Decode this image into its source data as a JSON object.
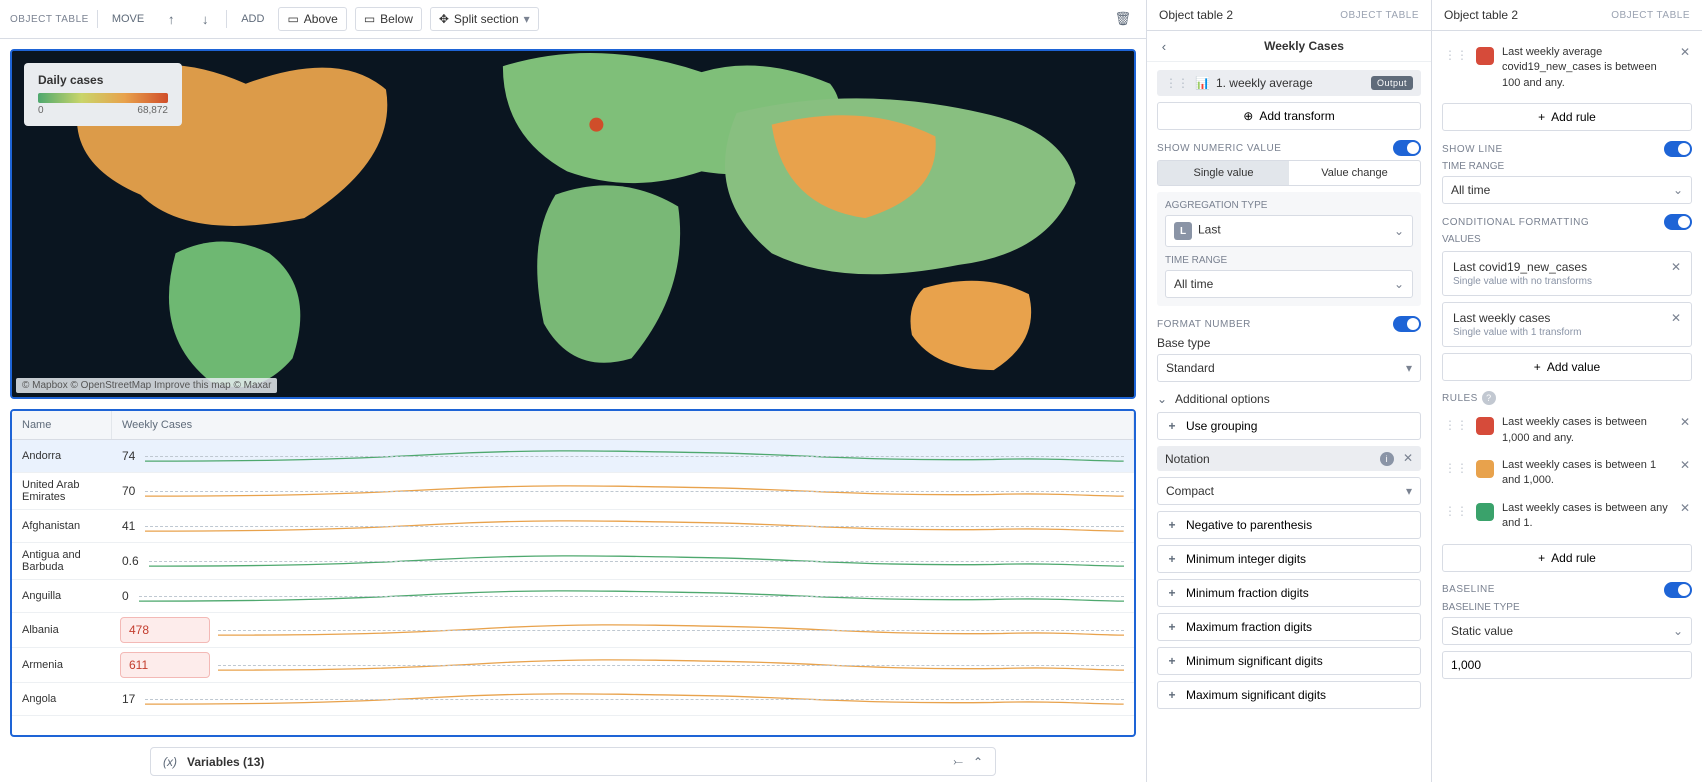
{
  "toolbar": {
    "label": "OBJECT TABLE",
    "move": "MOVE",
    "add": "ADD",
    "above": "Above",
    "below": "Below",
    "split": "Split section"
  },
  "map": {
    "legend_title": "Daily cases",
    "legend_min": "0",
    "legend_max": "68,872",
    "attribution": "© Mapbox © OpenStreetMap Improve this map © Maxar"
  },
  "table": {
    "headers": {
      "name": "Name",
      "cases": "Weekly Cases"
    },
    "rows": [
      {
        "name": "Andorra",
        "value": "74",
        "alert": false,
        "color": "#4ea86e"
      },
      {
        "name": "United Arab Emirates",
        "value": "70",
        "alert": false,
        "color": "#e8a24c"
      },
      {
        "name": "Afghanistan",
        "value": "41",
        "alert": false,
        "color": "#e8a24c"
      },
      {
        "name": "Antigua and Barbuda",
        "value": "0.6",
        "alert": false,
        "color": "#4ea86e"
      },
      {
        "name": "Anguilla",
        "value": "0",
        "alert": false,
        "color": "#4ea86e"
      },
      {
        "name": "Albania",
        "value": "478",
        "alert": true,
        "color": "#e8a24c"
      },
      {
        "name": "Armenia",
        "value": "611",
        "alert": true,
        "color": "#e8a24c"
      },
      {
        "name": "Angola",
        "value": "17",
        "alert": false,
        "color": "#e8a24c"
      }
    ]
  },
  "footer": {
    "variables": "Variables (13)"
  },
  "panel2": {
    "header_title": "Object table 2",
    "header_type": "OBJECT TABLE",
    "subtitle": "Weekly Cases",
    "transform_label": "1. weekly average",
    "output_chip": "Output",
    "add_transform": "Add transform",
    "show_numeric": "SHOW NUMERIC VALUE",
    "seg_single": "Single value",
    "seg_change": "Value change",
    "agg_label": "AGGREGATION TYPE",
    "agg_value": "Last",
    "time_label": "TIME RANGE",
    "time_value": "All time",
    "format_number": "FORMAT NUMBER",
    "base_type_label": "Base type",
    "base_type_value": "Standard",
    "additional_options": "Additional options",
    "use_grouping": "Use grouping",
    "notation_label": "Notation",
    "notation_value": "Compact",
    "opts": {
      "neg": "Negative to parenthesis",
      "minint": "Minimum integer digits",
      "minfrac": "Minimum fraction digits",
      "maxfrac": "Maximum fraction digits",
      "minsig": "Minimum significant digits",
      "maxsig": "Maximum significant digits"
    }
  },
  "panel3": {
    "header_title": "Object table 2",
    "header_type": "OBJECT TABLE",
    "top_rule_text": "Last weekly average covid19_new_cases is between 100 and any.",
    "add_rule": "Add rule",
    "show_line": "SHOW LINE",
    "time_range_label": "TIME RANGE",
    "time_range_value": "All time",
    "cond_format": "CONDITIONAL FORMATTING",
    "values_label": "VALUES",
    "values": [
      {
        "title": "Last covid19_new_cases",
        "sub": "Single value with no transforms"
      },
      {
        "title": "Last weekly cases",
        "sub": "Single value with 1 transform"
      }
    ],
    "add_value": "Add value",
    "rules_label": "RULES",
    "rules": [
      {
        "color": "#d64b3a",
        "text": "Last weekly cases is between 1,000 and any."
      },
      {
        "color": "#e8a24c",
        "text": "Last weekly cases is between 1 and 1,000."
      },
      {
        "color": "#3aa26b",
        "text": "Last weekly cases is between any and 1."
      }
    ],
    "baseline_label": "BASELINE",
    "baseline_type_label": "BASELINE TYPE",
    "baseline_type_value": "Static value",
    "baseline_input": "1,000"
  }
}
